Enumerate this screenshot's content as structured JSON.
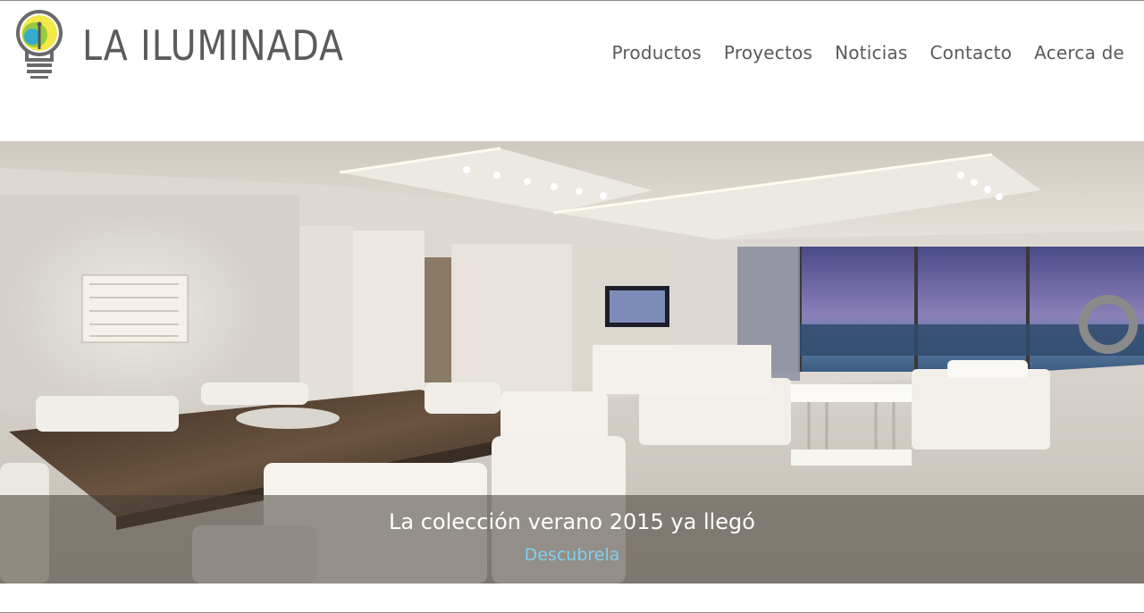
{
  "brand": {
    "name": "LA ILUMINADA",
    "logo_icon": "lightbulb-icon",
    "colors": {
      "bulb_yellow": "#f3e84a",
      "bulb_green": "#8cc63f",
      "bulb_blue": "#29a9e0",
      "text_gray": "#5b5b5b"
    }
  },
  "nav": {
    "items": [
      {
        "label": "Productos"
      },
      {
        "label": "Proyectos"
      },
      {
        "label": "Noticias"
      },
      {
        "label": "Contacto"
      },
      {
        "label": "Acerca de"
      }
    ]
  },
  "hero": {
    "image": "living-room-with-led-lighting",
    "caption_title": "La colección verano 2015 ya llegó",
    "caption_link": "Descubrela",
    "link_color": "#7fd1ee"
  }
}
